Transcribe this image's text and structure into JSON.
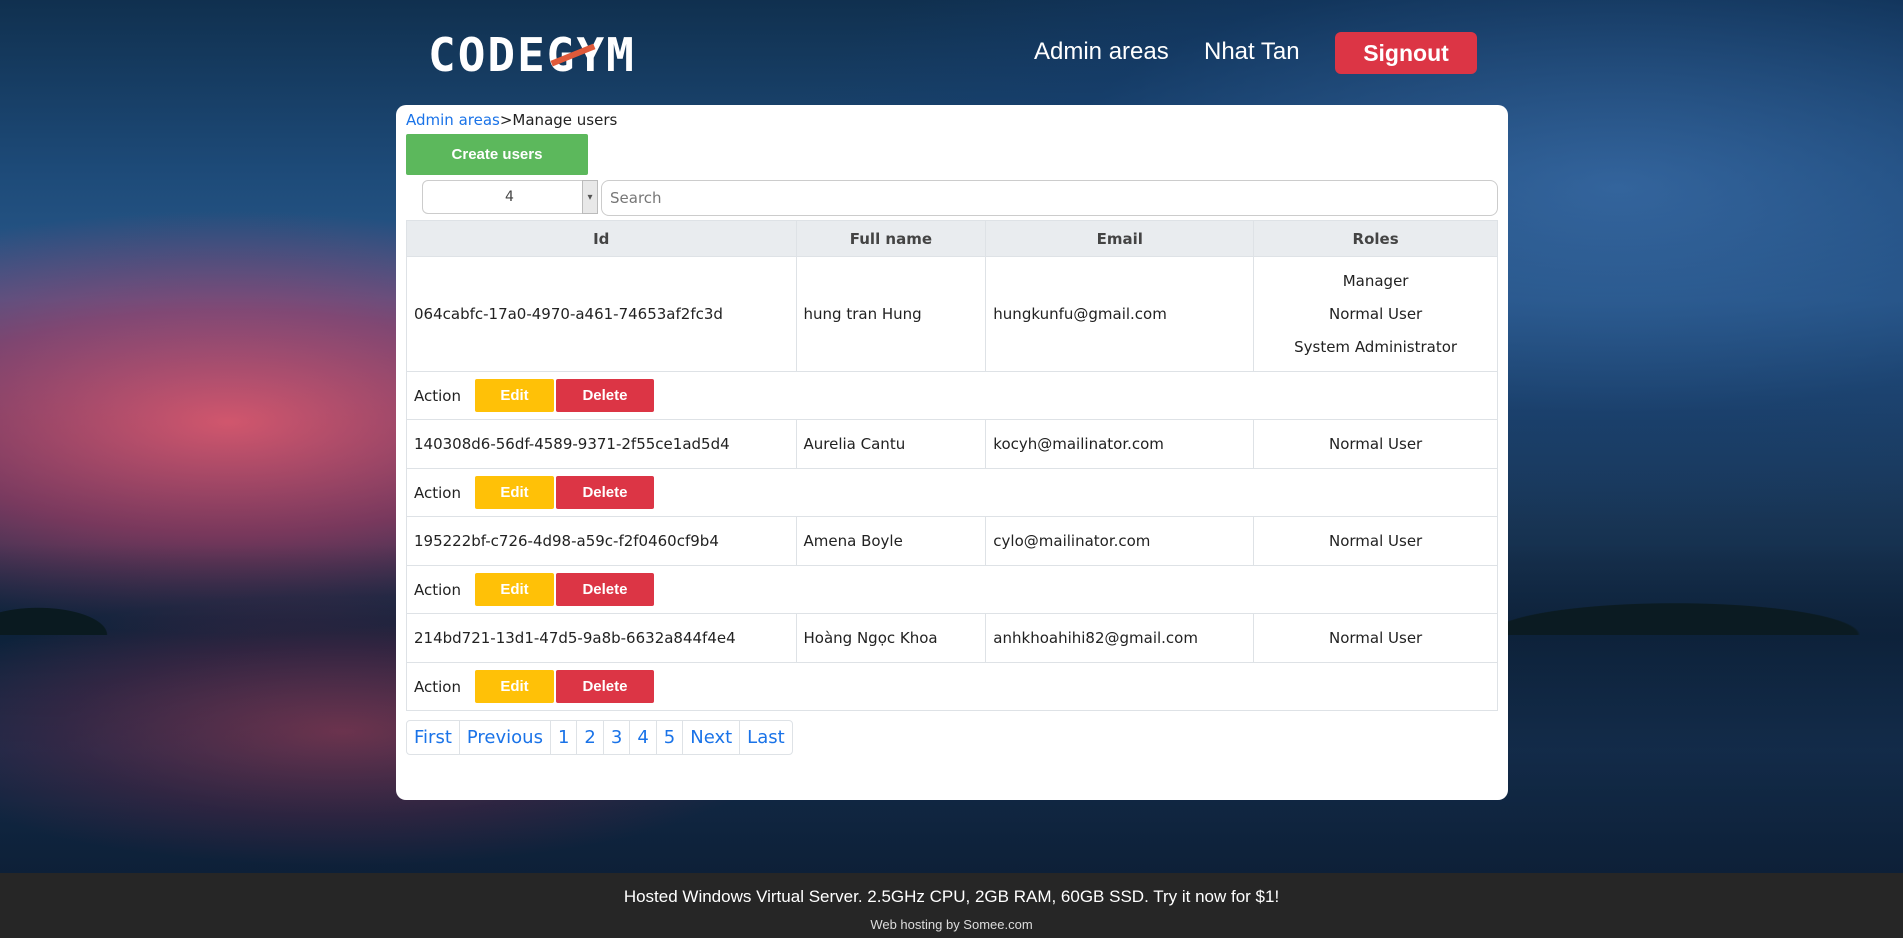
{
  "header": {
    "logo": "CODEGYM",
    "nav_admin": "Admin areas",
    "nav_user": "Nhat Tan",
    "signout_label": "Signout"
  },
  "breadcrumb": {
    "parent": "Admin areas",
    "separator": ">",
    "current": "Manage users"
  },
  "toolbar": {
    "create_label": "Create users",
    "page_size": "4",
    "search_placeholder": "Search"
  },
  "table": {
    "columns": [
      "Id",
      "Full name",
      "Email",
      "Roles"
    ],
    "rows": [
      {
        "id": "064cabfc-17a0-4970-a461-74653af2fc3d",
        "full_name": "hung tran Hung",
        "email": "hungkunfu@gmail.com",
        "roles": [
          "Manager",
          "Normal User",
          "System Administrator"
        ]
      },
      {
        "id": "140308d6-56df-4589-9371-2f55ce1ad5d4",
        "full_name": "Aurelia Cantu",
        "email": "kocyh@mailinator.com",
        "roles": [
          "Normal User"
        ]
      },
      {
        "id": "195222bf-c726-4d98-a59c-f2f0460cf9b4",
        "full_name": "Amena Boyle",
        "email": "cylo@mailinator.com",
        "roles": [
          "Normal User"
        ]
      },
      {
        "id": "214bd721-13d1-47d5-9a8b-6632a844f4e4",
        "full_name": "Hoàng Ngọc Khoa",
        "email": "anhkhoahihi82@gmail.com",
        "roles": [
          "Normal User"
        ]
      }
    ],
    "action_label": "Action",
    "edit_label": "Edit",
    "delete_label": "Delete"
  },
  "pagination": [
    "First",
    "Previous",
    "1",
    "2",
    "3",
    "4",
    "5",
    "Next",
    "Last"
  ],
  "footer": {
    "main": "Hosted Windows Virtual Server. 2.5GHz CPU, 2GB RAM, 60GB SSD. Try it now for $1!",
    "sub": "Web hosting by Somee.com"
  },
  "colors": {
    "signout": "#dc3545",
    "create": "#5cb85c",
    "edit": "#ffc107",
    "delete": "#dc3545",
    "link": "#1a73e8",
    "footer": "#262626"
  }
}
